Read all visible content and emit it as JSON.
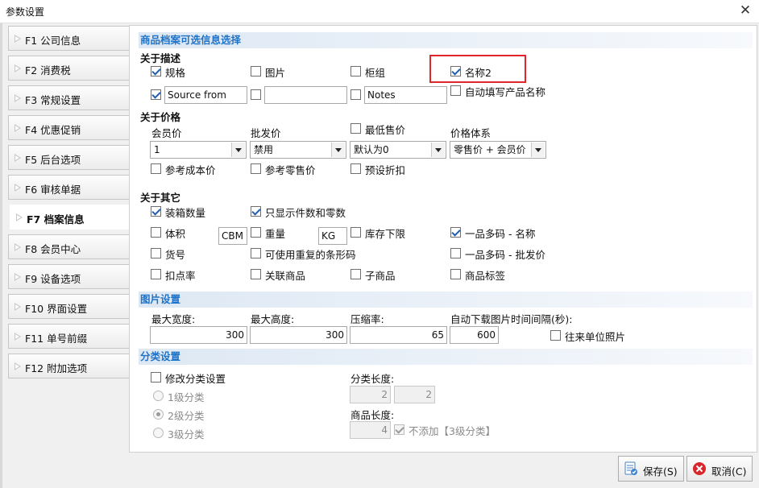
{
  "window": {
    "title": "参数设置",
    "close_glyph": "✕"
  },
  "sidebar": {
    "items": [
      {
        "label": "F1 公司信息"
      },
      {
        "label": "F2 消费税"
      },
      {
        "label": "F3 常规设置"
      },
      {
        "label": "F4 优惠促销"
      },
      {
        "label": "F5 后台选项"
      },
      {
        "label": "F6 审核单据"
      },
      {
        "label": "F7 档案信息"
      },
      {
        "label": "F8 会员中心"
      },
      {
        "label": "F9 设备选项"
      },
      {
        "label": "F10 界面设置"
      },
      {
        "label": "F11 单号前缀"
      },
      {
        "label": "F12 附加选项"
      }
    ],
    "active_index": 6
  },
  "sections": {
    "product_info": "商品档案可选信息选择",
    "image": "图片设置",
    "category": "分类设置"
  },
  "desc": {
    "group": "关于描述",
    "spec": "规格",
    "picture": "图片",
    "cabinet": "柜组",
    "name2": "名称2",
    "custom1_value": "Source from",
    "custom2_value": "",
    "custom3_value": "Notes",
    "auto_fill": "自动填写产品名称"
  },
  "price": {
    "group": "关于价格",
    "member_price": "会员价",
    "member_price_value": "1",
    "wholesale": "批发价",
    "wholesale_value": "禁用",
    "min_price": "最低售价",
    "min_price_value": "默认为0",
    "system": "价格体系",
    "system_value": "零售价 + 会员价",
    "ref_cost": "参考成本价",
    "ref_retail": "参考零售价",
    "preset_discount": "预设折扣"
  },
  "other": {
    "group": "关于其它",
    "box_qty": "装箱数量",
    "show_pieces": "只显示件数和零数",
    "volume": "体积",
    "volume_unit": "CBM",
    "weight": "重量",
    "weight_unit": "KG",
    "stock_lower": "库存下限",
    "multi_code_name": "一品多码 - 名称",
    "item_no": "货号",
    "dup_barcode": "可使用重复的条形码",
    "multi_code_wholesale": "一品多码 - 批发价",
    "point_rate": "扣点率",
    "related": "关联商品",
    "sub_product": "子商品",
    "product_tag": "商品标签"
  },
  "image": {
    "max_width_label": "最大宽度:",
    "max_width": "300",
    "max_height_label": "最大高度:",
    "max_height": "300",
    "compress_label": "压缩率:",
    "compress": "65",
    "interval_label": "自动下载图片时间间隔(秒):",
    "interval": "600",
    "partner_photo": "往来单位照片"
  },
  "category": {
    "modify": "修改分类设置",
    "level1": "1级分类",
    "level2": "2级分类",
    "level3": "3级分类",
    "cat_len_label": "分类长度:",
    "cat_len1": "2",
    "cat_len2": "2",
    "prod_len_label": "商品长度:",
    "prod_len": "4",
    "no_add": "不添加【3级分类】"
  },
  "buttons": {
    "save": "保存(S)",
    "cancel": "取消(C)"
  },
  "colors": {
    "accent": "#1e73c8",
    "highlight": "#e0262b"
  }
}
